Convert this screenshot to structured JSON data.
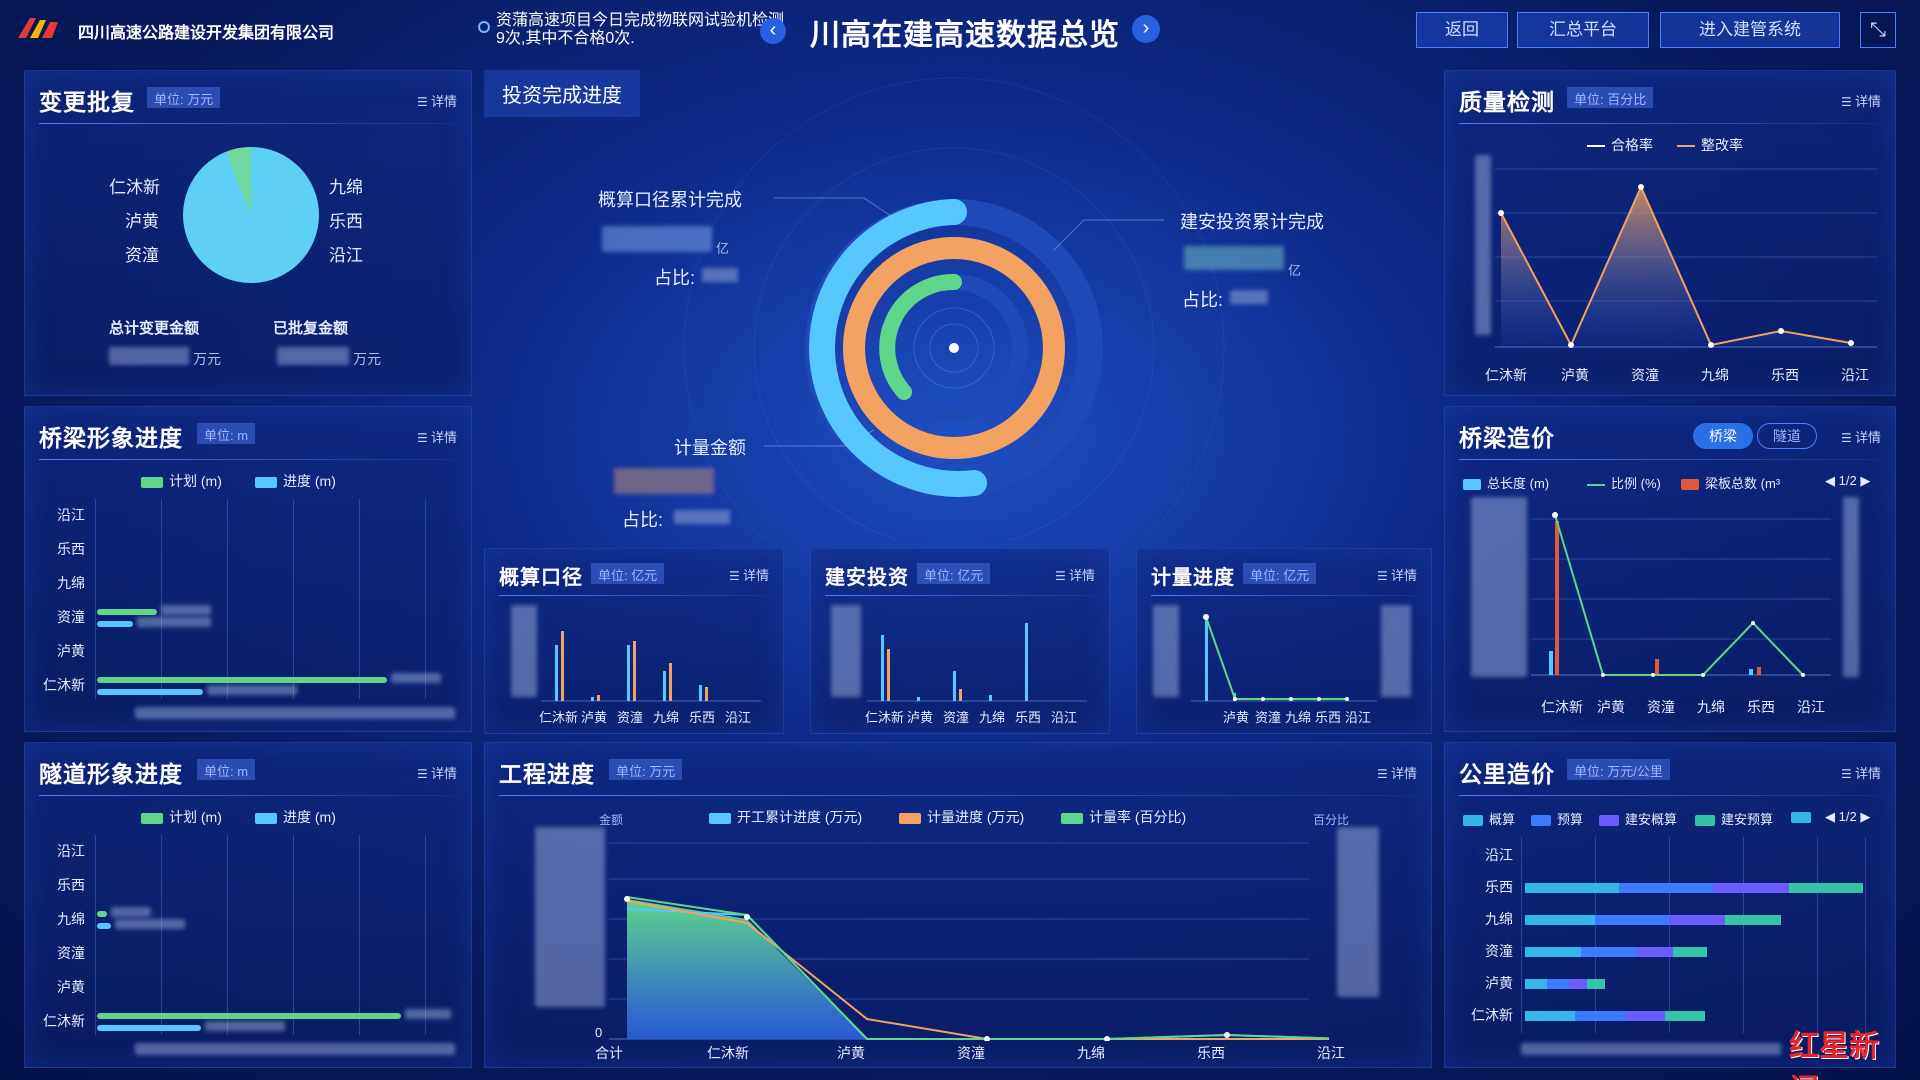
{
  "header": {
    "company": "四川高速公路建设开发集团有限公司",
    "ticker": "资蒲高速项目今日完成物联网试验机检测9次,其中不合格0次.",
    "title": "川高在建高速数据总览",
    "btn_back": "返回",
    "btn_summary": "汇总平台",
    "btn_enter": "进入建管系统",
    "prev_arrow": "‹",
    "next_arrow": "›",
    "collapse_icon": "⤡"
  },
  "common": {
    "detail_label": "详情"
  },
  "change_approval": {
    "title": "变更批复",
    "unit": "单位: 万元",
    "left_names": [
      "仁沐新",
      "泸黄",
      "资潼"
    ],
    "right_names": [
      "九绵",
      "乐西",
      "沿江"
    ],
    "total_label": "总计变更金额",
    "total_unit": "万元",
    "approved_label": "已批复金额",
    "approved_unit": "万元",
    "pie_colors": [
      "#5fd0f5",
      "#6fd9a0"
    ]
  },
  "investment": {
    "title": "投资完成进度",
    "budget_label": "概算口径累计完成",
    "budget_unit": "亿",
    "budget_ratio_label": "占比:",
    "construction_label": "建安投资累计完成",
    "construction_unit": "亿",
    "construction_ratio_label": "占比:",
    "metering_label": "计量金额",
    "metering_ratio_label": "占比:"
  },
  "quality": {
    "title": "质量检测",
    "unit": "单位: 百分比",
    "legend": [
      "合格率",
      "整改率"
    ],
    "categories": [
      "仁沐新",
      "泸黄",
      "资潼",
      "九绵",
      "乐西",
      "沿江"
    ]
  },
  "bridge_progress": {
    "title": "桥梁形象进度",
    "unit": "单位: m",
    "legend": [
      "计划 (m)",
      "进度 (m)"
    ],
    "rows": [
      "沿江",
      "乐西",
      "九绵",
      "资潼",
      "泸黄",
      "仁沐新"
    ]
  },
  "tunnel_progress": {
    "title": "隧道形象进度",
    "unit": "单位: m",
    "legend": [
      "计划 (m)",
      "进度 (m)"
    ],
    "rows": [
      "沿江",
      "乐西",
      "九绵",
      "资潼",
      "泸黄",
      "仁沐新"
    ]
  },
  "bridge_cost": {
    "title": "桥梁造价",
    "tab_bridge": "桥梁",
    "tab_tunnel": "隧道",
    "legend": [
      "总长度 (m)",
      "比例 (%)",
      "梁板总数 (m³"
    ],
    "pager": "1/2",
    "categories": [
      "仁沐新",
      "泸黄",
      "资潼",
      "九绵",
      "乐西",
      "沿江"
    ]
  },
  "budget_caliber": {
    "title": "概算口径",
    "unit": "单位: 亿元",
    "categories": [
      "仁沐新",
      "泸黄",
      "资潼",
      "九绵",
      "乐西",
      "沿江"
    ]
  },
  "construction_invest": {
    "title": "建安投资",
    "unit": "单位: 亿元",
    "categories": [
      "仁沐新",
      "泸黄",
      "资潼",
      "九绵",
      "乐西",
      "沿江"
    ]
  },
  "metering_progress": {
    "title": "计量进度",
    "unit": "单位: 亿元",
    "categories": [
      "泸黄",
      "资潼",
      "九绵",
      "乐西",
      "沿江"
    ]
  },
  "engineering": {
    "title": "工程进度",
    "unit": "单位: 万元",
    "left_axis": "金额",
    "right_axis": "百分比",
    "legend": [
      "开工累计进度 (万元)",
      "计量进度 (万元)",
      "计量率 (百分比)"
    ],
    "categories": [
      "合计",
      "仁沐新",
      "泸黄",
      "资潼",
      "九绵",
      "乐西",
      "沿江"
    ],
    "zero": "0"
  },
  "km_cost": {
    "title": "公里造价",
    "unit": "单位: 万元/公里",
    "legend": [
      "概算",
      "预算",
      "建安概算",
      "建安预算"
    ],
    "pager": "1/2",
    "rows": [
      "沿江",
      "乐西",
      "九绵",
      "资潼",
      "泸黄",
      "仁沐新"
    ]
  },
  "watermark": "红星新闻",
  "colors": {
    "cyan": "#56c8ff",
    "green": "#5fd68a",
    "orange": "#f4a261",
    "blue": "#3a7bff",
    "purple": "#6a5cff",
    "teal": "#35c3a8",
    "red": "#e05a3a"
  }
}
